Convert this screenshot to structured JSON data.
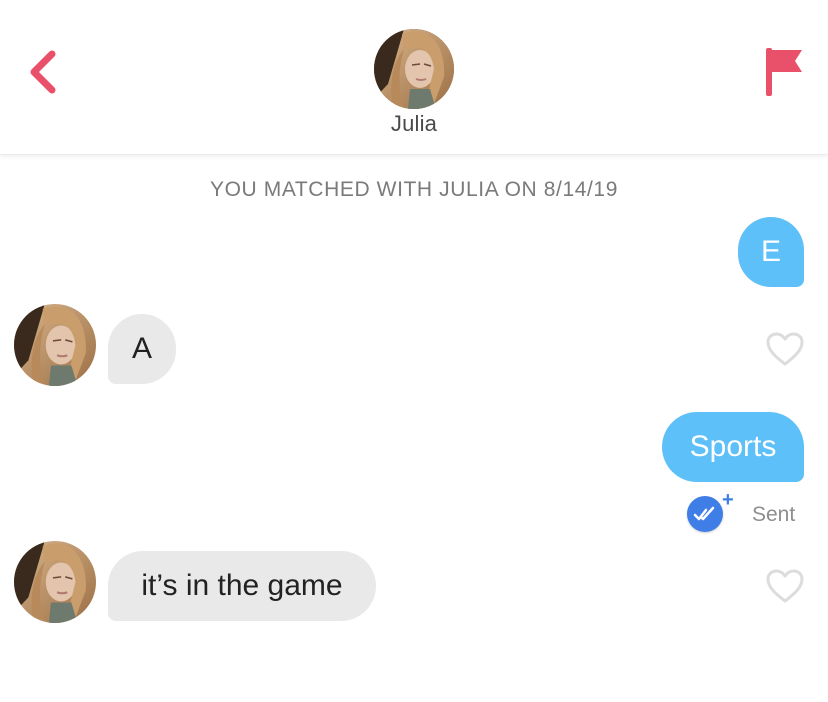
{
  "header": {
    "contact_name": "Julia",
    "icons": {
      "back": "chevron-left-icon",
      "report": "flag-icon"
    }
  },
  "match_banner": "YOU MATCHED WITH JULIA ON 8/14/19",
  "messages": [
    {
      "from": "me",
      "text": "E"
    },
    {
      "from": "them",
      "text": "A"
    },
    {
      "from": "me",
      "text": "Sports"
    },
    {
      "from": "them",
      "text": "it’s in the game"
    }
  ],
  "status": {
    "sent_label": "Sent",
    "badge_plus": "+"
  },
  "colors": {
    "accent_red": "#e9506a",
    "outgoing_bubble": "#5ec0f8",
    "incoming_bubble": "#e9e9ea",
    "read_badge": "#3f7ee6"
  }
}
